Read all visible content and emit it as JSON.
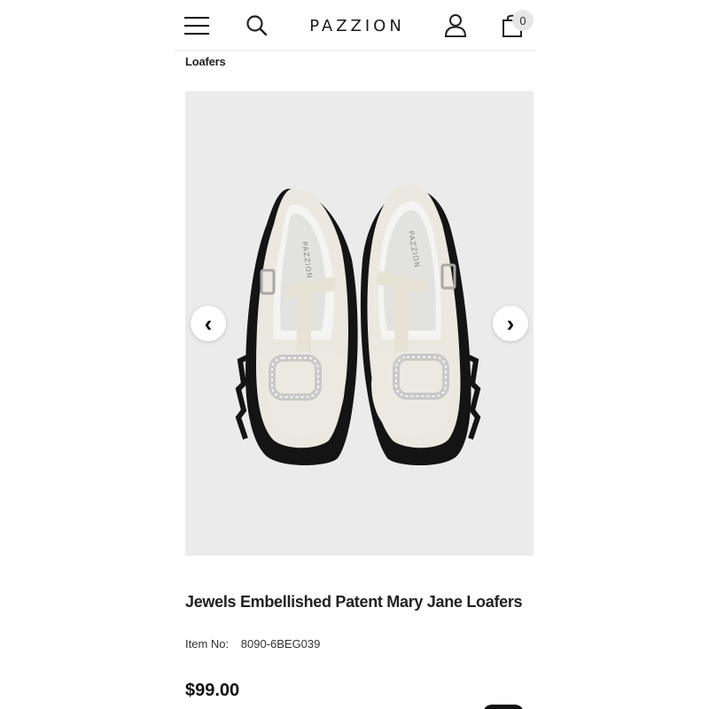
{
  "header": {
    "brand": "PAZZION",
    "cart_count": "0",
    "menu_icon": "hamburger-menu-icon",
    "search_icon": "search-icon",
    "account_icon": "user-icon",
    "cart_icon": "shopping-bag-icon"
  },
  "breadcrumb": "Loafers",
  "gallery": {
    "prev_arrow": "‹",
    "next_arrow": "›",
    "image_alt": "Jewels Embellished Patent Mary Jane Loafers",
    "insole_brand": "PAZZION"
  },
  "product": {
    "title": "Jewels Embellished Patent Mary Jane Loafers",
    "item_no_label": "Item No:",
    "item_no": "8090-6BEG039",
    "price": "$99.00"
  },
  "colors": {
    "background": "#ffffff",
    "gallery_bg": "#ebebeb",
    "shoe_upper": "#ebe8df",
    "sole": "#141414",
    "text": "#1a1a1a"
  }
}
